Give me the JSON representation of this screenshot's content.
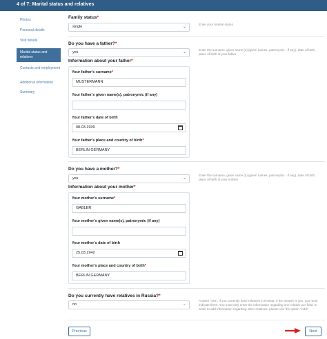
{
  "header": {
    "title": "4 of 7: Marital status and relatives"
  },
  "sidebar": {
    "items": [
      {
        "label": "Photos"
      },
      {
        "label": "Personal details"
      },
      {
        "label": "Visit details"
      },
      {
        "label": "Marital status and relatives"
      },
      {
        "label": "Contacts and employment"
      },
      {
        "label": "Additional information"
      },
      {
        "label": "Summary"
      }
    ]
  },
  "family_status": {
    "label": "Family status",
    "required": "*",
    "value": "single",
    "hint": "Enter your marital status"
  },
  "father": {
    "question": "Do you have a father?",
    "required": "*",
    "value": "yes",
    "hint": "Enter the surname, given name (s) (given names, patronymic - if any), date of birth, place of birth of your father",
    "info_title": "Information about your father",
    "surname_label": "Your father's surname",
    "surname_value": "MUSTERMANN",
    "given_label": "Your father's given name(s), patronymic (if any)",
    "given_value": "",
    "dob_label": "Your father's date of birth",
    "dob_value": "08.03.1939",
    "place_label": "Your father's place and country of birth",
    "place_value": "BERLIN GERMANY"
  },
  "mother": {
    "question": "Do you have a mother?",
    "required": "*",
    "value": "yes",
    "hint": "Enter the surname, given name (s) (given names, patronymic - if any), date of birth, place of birth of your mother",
    "info_title": "Information about your mother",
    "surname_label": "Your mother's surname",
    "surname_value": "GABLER",
    "given_label": "Your mother's given name(s), patronymic (if any)",
    "given_value": "",
    "dob_label": "Your mother's date of birth",
    "dob_value": "25.03.1942",
    "place_label": "Your mother's place and country of birth",
    "place_value": "BERLIN GERMANY"
  },
  "relatives": {
    "question": "Do you currently have relatives in Russia?",
    "required": "*",
    "value": "no",
    "hint": "Answer \"yes\", if you currently have relatives in Russia. If the answer is yes, you must indicate them. You must only enter the information regarding one relative per field. In order to add information regarding other relatives, please use the option \"Add\""
  },
  "nav": {
    "previous_label": "Previous",
    "next_label": "Next"
  },
  "colors": {
    "header": "#2f5d85",
    "accent": "#3f6f9a",
    "arrow": "#d31f1f"
  }
}
